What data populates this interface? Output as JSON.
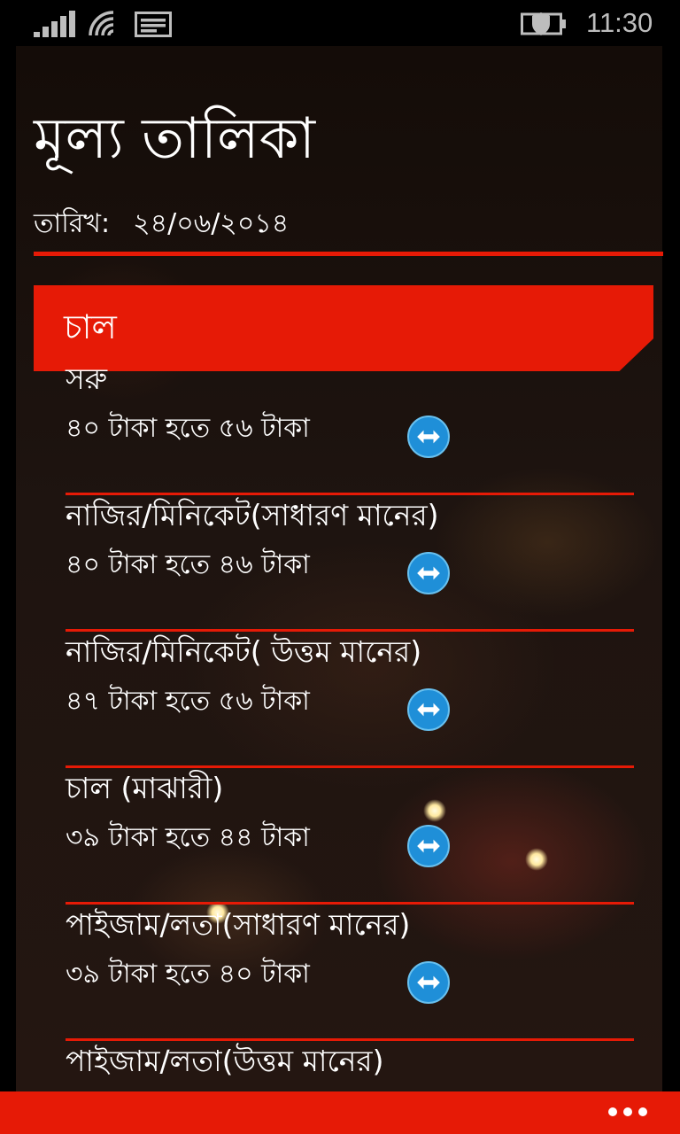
{
  "status_bar": {
    "time": "11:30",
    "icons": [
      "signal-icon",
      "wifi-icon",
      "message-icon",
      "battery-saver-icon"
    ]
  },
  "page": {
    "title": "মূল্য তালিকা",
    "date_label": "তারিখ:",
    "date_value": "২৪/০৬/২০১৪"
  },
  "category": {
    "name": "চাল"
  },
  "items": [
    {
      "name": "সরু",
      "price": "৪০ টাকা হতে ৫৬ টাকা"
    },
    {
      "name": "নাজির/মিনিকেট(সাধারণ মানের)",
      "price": "৪০ টাকা হতে ৪৬ টাকা"
    },
    {
      "name": "নাজির/মিনিকেট( উত্তম মানের)",
      "price": "৪৭ টাকা হতে ৫৬ টাকা"
    },
    {
      "name": "চাল (মাঝারী)",
      "price": "৩৯ টাকা হতে ৪৪ টাকা"
    },
    {
      "name": "পাইজাম/লতা(সাধারণ মানের)",
      "price": "৩৯ টাকা হতে ৪০ টাকা"
    },
    {
      "name": "পাইজাম/লতা(উত্তম মানের)",
      "price": ""
    }
  ],
  "colors": {
    "accent": "#e61a06",
    "swap_button": "#1f8fd8",
    "background": "#000000"
  },
  "app_bar": {
    "more_icon": "ellipsis-icon"
  }
}
